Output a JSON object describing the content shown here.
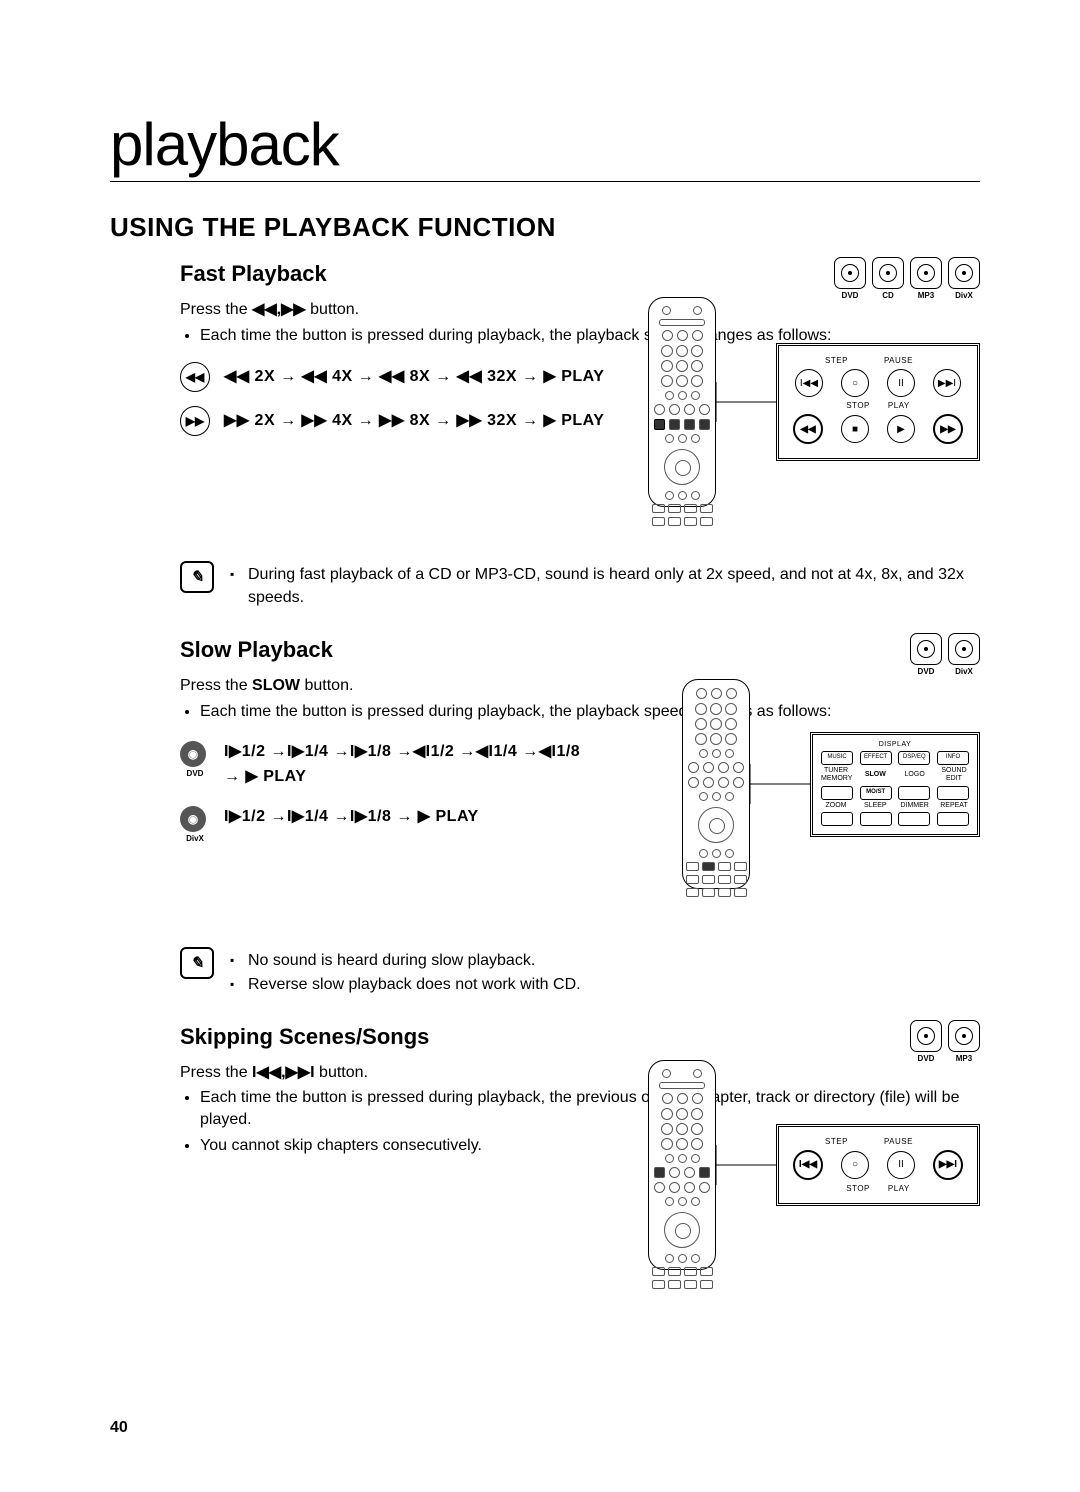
{
  "chapter": "playback",
  "section_title": "USING THE PLAYBACK FUNCTION",
  "page_number": "40",
  "formats": {
    "dvd": "DVD",
    "cd": "CD",
    "mp3": "MP3",
    "divx": "DivX"
  },
  "fast": {
    "title": "Fast Playback",
    "press_pre": "Press the ",
    "press_icons": "◀◀,▶▶",
    "press_post": " button.",
    "bullet1": "Each time the button is pressed during playback, the playback speed changes as follows:",
    "seq_rew": "◀◀ 2X → ◀◀ 4X → ◀◀ 8X → ◀◀ 32X → ▶ PLAY",
    "seq_ff": "▶▶ 2X → ▶▶ 4X → ▶▶ 8X → ▶▶ 32X → ▶ PLAY",
    "note1": "During fast playback of a CD or MP3-CD, sound is heard only at 2x speed, and not at 4x, 8x, and 32x speeds."
  },
  "slow": {
    "title": "Slow Playback",
    "press_pre": "Press the ",
    "press_btn": "SLOW",
    "press_post": " button.",
    "bullet1": "Each time the button is pressed during playback, the playback speed changes as follows:",
    "seq_dvd": "I▶1/2 →I▶1/4 →I▶1/8 →◀I1/2 →◀I1/4 →◀I1/8 → ▶ PLAY",
    "seq_divx": "I▶1/2 →I▶1/4 →I▶1/8 → ▶ PLAY",
    "note1": "No sound is heard during slow playback.",
    "note2": "Reverse slow playback does not work with CD."
  },
  "skip": {
    "title": "Skipping Scenes/Songs",
    "press_pre": "Press the ",
    "press_icons": "I◀◀,▶▶I",
    "press_post": " button.",
    "bullet1": "Each time the button is pressed during playback, the previous or next chapter, track or directory (file) will be played.",
    "bullet2": "You cannot skip chapters consecutively."
  },
  "panel1": {
    "step": "STEP",
    "pause": "PAUSE",
    "stop": "STOP",
    "play": "PLAY",
    "prev": "I◀◀",
    "pauseSym": "II",
    "next": "▶▶I",
    "rew": "◀◀",
    "stopSym": "■",
    "playSym": "▶",
    "ff": "▶▶"
  },
  "panel2": {
    "caption": "DISPLAY",
    "row1": [
      "MUSIC",
      "EFFECT",
      "DSP/EQ",
      "INFO"
    ],
    "row2_lbl": [
      "TUNER MEMORY",
      "SLOW",
      "LOGO",
      "SOUND EDIT"
    ],
    "row3_lbl": [
      "ZOOM",
      "SLEEP",
      "DIMMER",
      "REPEAT"
    ]
  }
}
